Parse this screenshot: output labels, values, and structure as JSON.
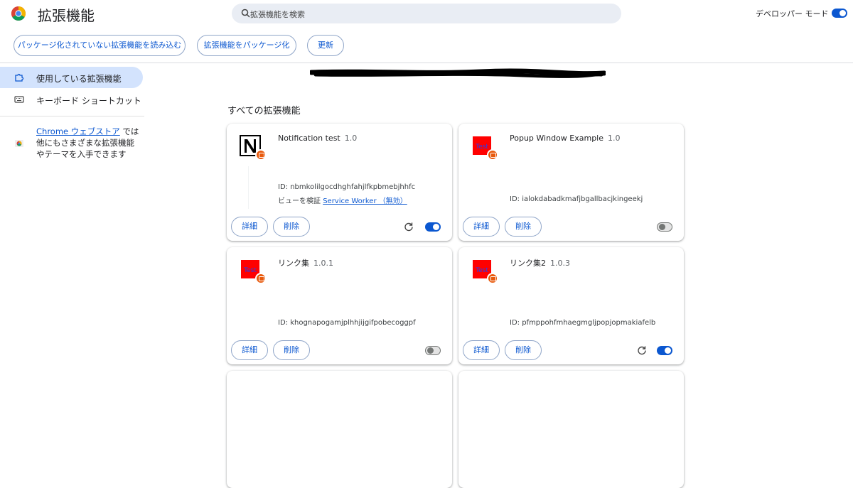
{
  "header": {
    "title": "拡張機能",
    "search_placeholder": "拡張機能を検索",
    "dev_mode_label": "デベロッパー モード",
    "dev_mode_on": true
  },
  "actions": {
    "load_unpacked": "パッケージ化されていない拡張機能を読み込む",
    "pack": "拡張機能をパッケージ化",
    "update": "更新"
  },
  "sidebar": {
    "items": [
      {
        "label": "使用している拡張機能",
        "icon": "puzzle-icon",
        "active": true
      },
      {
        "label": "キーボード ショートカット",
        "icon": "keyboard-icon",
        "active": false
      }
    ],
    "store_link": "Chrome ウェブストア",
    "store_text_1": " では",
    "store_text_2": "他にもさまざまな拡張機能",
    "store_text_3": "やテーマを入手できます"
  },
  "main": {
    "section_title": "すべての拡張機能",
    "cards": [
      {
        "name": "Notification test",
        "version": "1.0",
        "id": "ID: nbmkolilgocdhghfahjlfkpbmebjhhfc",
        "view_label": "ビューを検証",
        "view_link": "Service Worker （無効）",
        "enabled": true,
        "reload": true,
        "icon": "notion-logo-icon"
      },
      {
        "name": "Popup Window Example",
        "version": "1.0",
        "id": "ID: ialokdabadkmafjbgallbacjkingeekj",
        "enabled": false,
        "reload": false,
        "icon": "test-red-icon"
      },
      {
        "name": "リンク集",
        "version": "1.0.1",
        "id": "ID: khognapogamjplhhjijgifpobecoggpf",
        "enabled": false,
        "reload": false,
        "icon": "test-red-icon"
      },
      {
        "name": "リンク集2",
        "version": "1.0.3",
        "id": "ID: pfmppohfmhaegmgljpopjopmakiafelb",
        "enabled": true,
        "reload": true,
        "icon": "test-red-icon"
      }
    ],
    "details_label": "詳細",
    "remove_label": "削除"
  },
  "colors": {
    "accent": "#0b57d0",
    "active_bg": "#d3e3fd",
    "search_bg": "#e9edf4",
    "badge": "#e8590c"
  }
}
